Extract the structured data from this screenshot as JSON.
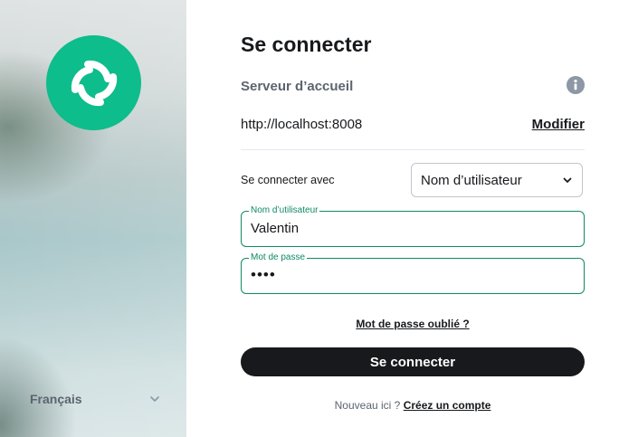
{
  "sidebar": {
    "logo_icon": "element-logo-icon",
    "logo_color": "#0dbd8b",
    "language": "Français"
  },
  "login": {
    "title": "Se connecter",
    "server_label": "Serveur d’accueil",
    "server_url": "http://localhost:8008",
    "modify_label": "Modifier",
    "login_with_label": "Se connecter avec",
    "login_method": "Nom d’utilisateur",
    "username_label": "Nom d’utilisateur",
    "username_value": "Valentin",
    "password_label": "Mot de passe",
    "password_value": "••••",
    "forgot_password": "Mot de passe oublié ?",
    "submit_label": "Se connecter",
    "new_here": "Nouveau ici ?",
    "create_account": "Créez un compte"
  },
  "colors": {
    "accent": "#0dbd8b",
    "field_border": "#0f8a66",
    "button": "#17191c"
  }
}
